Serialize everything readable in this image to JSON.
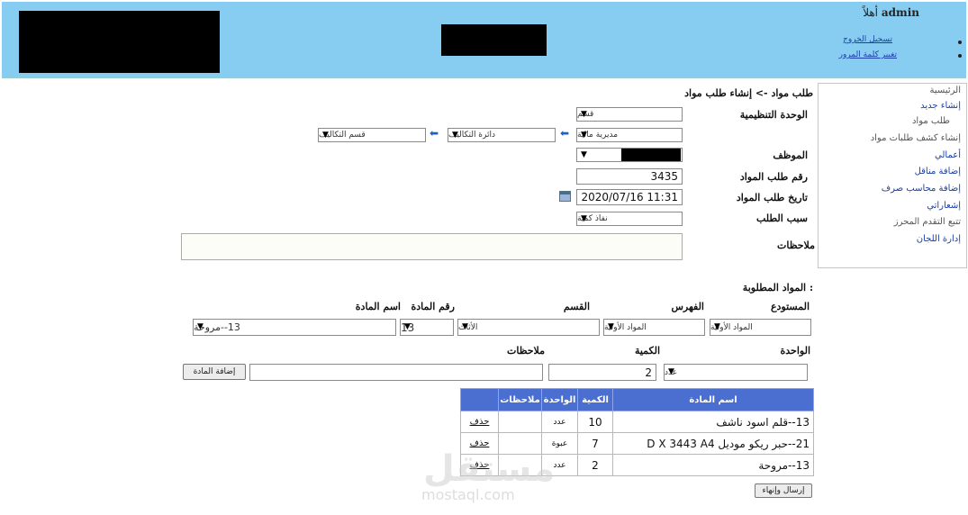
{
  "header": {
    "greeting": "أهلاً",
    "username": "admin",
    "links": [
      "تسجيل الخروج",
      "تغيير كلمة المرور"
    ]
  },
  "sidebar": {
    "items": [
      {
        "label": "الرئيسية",
        "link": false
      },
      {
        "label": "إنشاء جديد",
        "link": true
      },
      {
        "label": "طلب مواد",
        "link": false
      },
      {
        "label": "إنشاء كشف طلبات مواد",
        "link": false
      },
      {
        "label": "أعمالي",
        "link": true
      },
      {
        "label": "إضافة مناقل",
        "link": true
      },
      {
        "label": "إضافة محاسب صرف",
        "link": true
      },
      {
        "label": "إشعاراتي",
        "link": true
      },
      {
        "label": "تتبع التقدم المحرز",
        "link": false
      },
      {
        "label": "إدارة اللجان",
        "link": true
      }
    ]
  },
  "breadcrumb": "طلب مواد -> إنشاء طلب مواد",
  "form": {
    "org_unit_label": "الوحدة التنظيمية",
    "org_unit_value": "قسم",
    "dept_chain": [
      "مديرية مالية",
      "دائرة التكاليف",
      "قسم التكاليف"
    ],
    "employee_label": "الموظف",
    "request_number_label": "رقم طلب المواد",
    "request_number_value": "3435",
    "request_date_label": "تاريخ طلب المواد",
    "request_date_value": "2020/07/16 11:31",
    "reason_label": "سبب الطلب",
    "reason_value": "نفاذ كمية",
    "notes_label": "ملاحظات",
    "notes_value": ""
  },
  "items_section": {
    "title": "المواد المطلوبة :",
    "warehouse_label": "المستودع",
    "warehouse_value": "المواد الأولية",
    "index_label": "الفهرس",
    "index_value": "المواد الأولية",
    "section_label": "القسم",
    "section_value": "الأثاث",
    "item_no_label": "رقم المادة",
    "item_no_value": "13",
    "item_name_label": "اسم المادة",
    "item_name_value": "13--مروحة",
    "unit_label": "الواحدة",
    "unit_value": "عدد",
    "qty_label": "الكمية",
    "qty_value": "2",
    "notes_label": "ملاحظات",
    "notes_value": "",
    "add_button": "إضافة المادة"
  },
  "table": {
    "headers": {
      "name": "اسم المادة",
      "qty": "الكمية",
      "unit": "الواحدة",
      "notes": "ملاحظات"
    },
    "rows": [
      {
        "name": "13--قلم اسود ناشف",
        "qty": "10",
        "unit": "عدد",
        "notes": "",
        "action": "حذف"
      },
      {
        "name": "21--حبر ريكو موديل D X 3443 A4",
        "qty": "7",
        "unit": "عبوة",
        "notes": "",
        "action": "حذف"
      },
      {
        "name": "13--مروحة",
        "qty": "2",
        "unit": "عدد",
        "notes": "",
        "action": "حذف"
      }
    ]
  },
  "submit_button": "إرسال وإنهاء",
  "watermark": {
    "arabic": "مستقل",
    "latin": "mostaql.com"
  }
}
